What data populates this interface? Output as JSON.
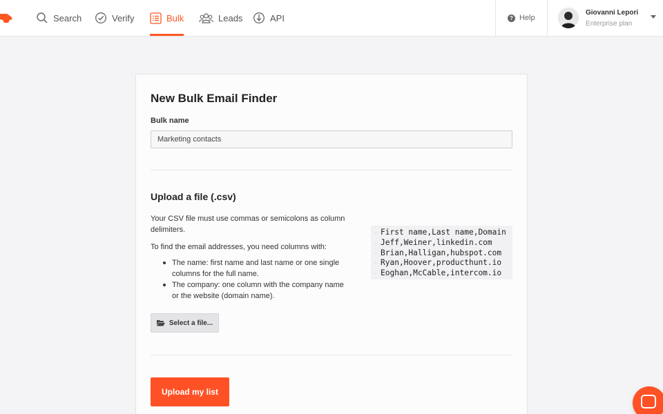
{
  "nav": {
    "items": [
      {
        "label": "Search",
        "icon": "search-icon"
      },
      {
        "label": "Verify",
        "icon": "check-circle-icon"
      },
      {
        "label": "Bulk",
        "icon": "list-icon",
        "active": true
      },
      {
        "label": "Leads",
        "icon": "users-icon"
      },
      {
        "label": "API",
        "icon": "api-icon"
      }
    ],
    "help_label": "Help",
    "user": {
      "name": "Giovanni Lepori",
      "plan": "Enterprise plan"
    }
  },
  "colors": {
    "accent": "#ff5722",
    "button": "#ff5126"
  },
  "form": {
    "title": "New Bulk Email Finder",
    "bulk_name_label": "Bulk name",
    "bulk_name_value": "Marketing contacts",
    "upload_title": "Upload a file (.csv)",
    "desc1": "Your CSV file must use commas or semicolons as column delimiters.",
    "desc2": "To find the email addresses, you need columns with:",
    "requirements": [
      "The name: first name and last name or one single columns for the full name.",
      "The company: one column with the company name or the website (domain name)."
    ],
    "select_file_label": "Select a file...",
    "sample_csv": [
      "First name,Last name,Domain",
      "Jeff,Weiner,linkedin.com",
      "Brian,Halligan,hubspot.com",
      "Ryan,Hoover,producthunt.io",
      "Eoghan,McCable,intercom.io"
    ],
    "upload_button_label": "Upload my list"
  }
}
